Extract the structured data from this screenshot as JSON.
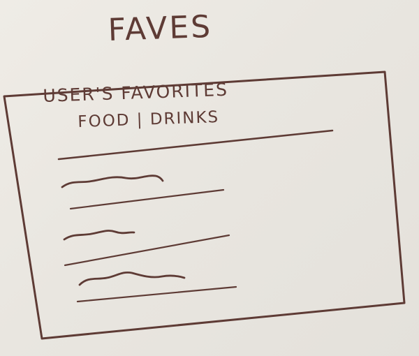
{
  "page_title": "FAVES",
  "card": {
    "header_line_1": "USER'S FAVORITES",
    "header_line_2": "FOOD | DRINKS",
    "items": [
      {
        "type": "list-item",
        "text": ""
      },
      {
        "type": "list-item",
        "text": ""
      },
      {
        "type": "list-item",
        "text": ""
      }
    ]
  }
}
